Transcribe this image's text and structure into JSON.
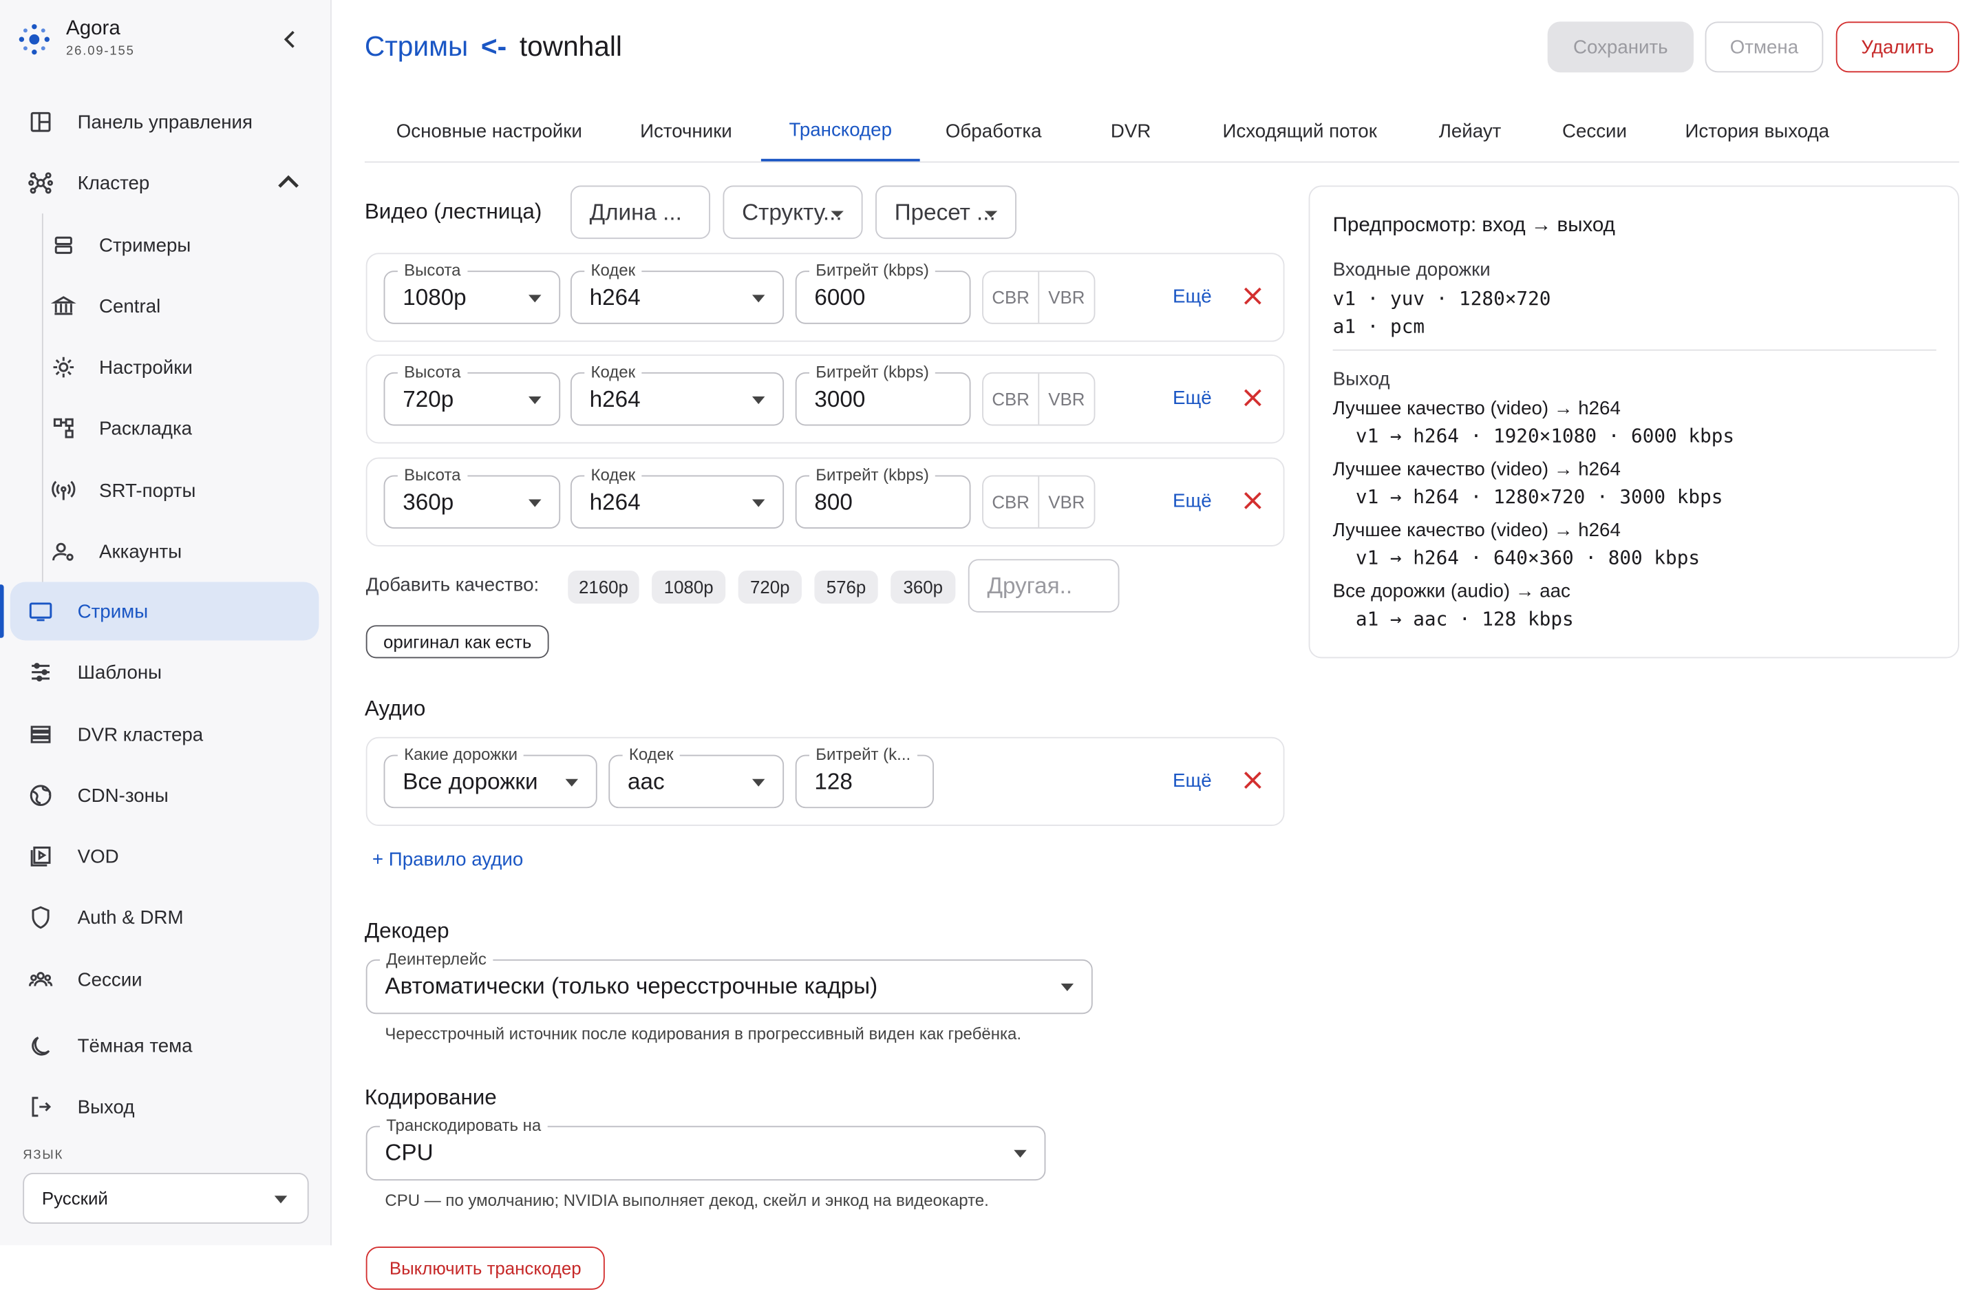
{
  "app": {
    "name": "Agora",
    "version": "26.09-155"
  },
  "sidebar": {
    "items": [
      {
        "label": "Панель управления"
      },
      {
        "label": "Кластер"
      },
      {
        "label": "Стримеры"
      },
      {
        "label": "Central"
      },
      {
        "label": "Настройки"
      },
      {
        "label": "Раскладка"
      },
      {
        "label": "SRT-порты"
      },
      {
        "label": "Аккаунты"
      },
      {
        "label": "Стримы"
      },
      {
        "label": "Шаблоны"
      },
      {
        "label": "DVR кластера"
      },
      {
        "label": "CDN-зоны"
      },
      {
        "label": "VOD"
      },
      {
        "label": "Auth & DRM"
      },
      {
        "label": "Сессии"
      },
      {
        "label": "Тёмная тема"
      },
      {
        "label": "Выход"
      }
    ],
    "active": "Стримы",
    "lang_label": "ЯЗЫК",
    "lang_value": "Русский"
  },
  "header": {
    "breadcrumb_root": "Стримы",
    "breadcrumb_sep": "<-",
    "stream_name": "townhall",
    "save": "Сохранить",
    "cancel": "Отмена",
    "delete": "Удалить"
  },
  "tabs": [
    "Основные настройки",
    "Источники",
    "Транскодер",
    "Обработка",
    "DVR",
    "Исходящий поток",
    "Лейаут",
    "Сессии",
    "История выхода"
  ],
  "active_tab": "Транскодер",
  "video": {
    "title": "Видео (лестница)",
    "buttons": [
      "Длина ...",
      "Структу...",
      "Пресет ..."
    ],
    "labels": {
      "height": "Высота",
      "codec": "Кодек",
      "bitrate": "Битрейт (kbps)"
    },
    "rows": [
      {
        "height": "1080p",
        "codec": "h264",
        "bitrate": "6000"
      },
      {
        "height": "720p",
        "codec": "h264",
        "bitrate": "3000"
      },
      {
        "height": "360p",
        "codec": "h264",
        "bitrate": "800"
      }
    ],
    "cbr": "CBR",
    "vbr": "VBR",
    "more": "Ещё",
    "add_label": "Добавить качество:",
    "add_chips": [
      "2160p",
      "1080p",
      "720p",
      "576p",
      "360p"
    ],
    "other_placeholder": "Другая..",
    "original_chip": "оригинал как есть"
  },
  "audio": {
    "title": "Аудио",
    "labels": {
      "tracks": "Какие дорожки",
      "codec": "Кодек",
      "bitrate": "Битрейт (k..."
    },
    "tracks": "Все дорожки",
    "codec": "aac",
    "bitrate": "128",
    "more": "Ещё",
    "add_rule": "+ Правило аудио"
  },
  "decoder": {
    "title": "Декодер",
    "label": "Деинтерлейс",
    "value": "Автоматически (только чересстрочные кадры)",
    "helper": "Чересстрочный источник после кодирования в прогрессивный виден как гребёнка."
  },
  "encoding": {
    "title": "Кодирование",
    "label": "Транскодировать на",
    "value": "CPU",
    "helper": "CPU — по умолчанию; NVIDIA выполняет декод, скейл и энкод на видеокарте."
  },
  "disable_button": "Выключить транскодер",
  "preview": {
    "title": "Предпросмотр: вход → выход",
    "inputs_title": "Входные дорожки",
    "inputs": [
      "v1 · yuv · 1280×720",
      "a1 · pcm"
    ],
    "output_title": "Выход",
    "outputs": [
      {
        "head": "Лучшее качество (video) → h264",
        "detail": "v1 → h264 · 1920×1080 · 6000 kbps"
      },
      {
        "head": "Лучшее качество (video) → h264",
        "detail": "v1 → h264 · 1280×720 · 3000 kbps"
      },
      {
        "head": "Лучшее качество (video) → h264",
        "detail": "v1 → h264 · 640×360 · 800 kbps"
      },
      {
        "head": "Все дорожки (audio) → aac",
        "detail": "a1 → aac · 128 kbps"
      }
    ]
  },
  "colors": {
    "accent": "#1a56c4",
    "danger": "#c62828",
    "active_bg": "#dde6f6"
  }
}
